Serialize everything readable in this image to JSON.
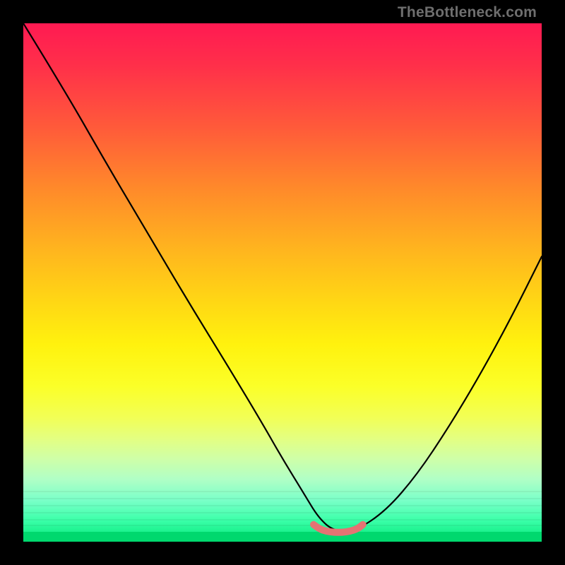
{
  "attribution": "TheBottleneck.com",
  "chart_data": {
    "type": "line",
    "title": "",
    "xlabel": "",
    "ylabel": "",
    "xlim": [
      0,
      100
    ],
    "ylim": [
      0,
      100
    ],
    "series": [
      {
        "name": "bottleneck-curve",
        "x": [
          0,
          8,
          16,
          24,
          32,
          40,
          46,
          50,
          54,
          57,
          60,
          64,
          70,
          76,
          82,
          88,
          94,
          100
        ],
        "values": [
          100,
          87,
          73,
          59.5,
          46,
          33,
          23,
          16,
          9.5,
          4.5,
          2,
          2,
          6,
          13,
          22,
          32,
          43,
          55
        ]
      },
      {
        "name": "valley-marker",
        "x": [
          56,
          57,
          58.5,
          60,
          61.5,
          63,
          64.5,
          65.5
        ],
        "values": [
          3.3,
          2.5,
          2.0,
          1.8,
          1.8,
          2.0,
          2.5,
          3.3
        ]
      }
    ],
    "annotations": []
  },
  "colors": {
    "curve": "#000000",
    "valley_marker": "#e57373",
    "background_top": "#ff1a52",
    "background_bottom": "#00e676",
    "frame": "#000000"
  }
}
